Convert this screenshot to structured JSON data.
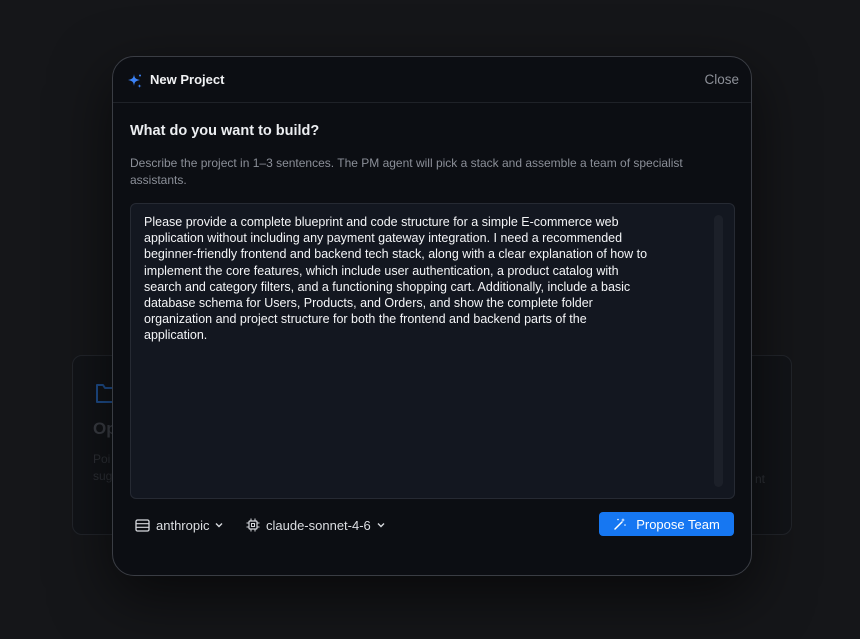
{
  "background": {
    "left_card": {
      "title": "Op",
      "description_lines": [
        "Poi",
        "sug"
      ],
      "icon": "folder-icon"
    },
    "right_card": {
      "text": "nt"
    }
  },
  "modal": {
    "title": "New Project",
    "close_label": "Close",
    "question": "What do you want to build?",
    "help_text": "Describe the project in 1–3 sentences. The PM agent will pick a stack and assemble a team of specialist assistants.",
    "prompt_value": "Please provide a complete blueprint and code structure for a simple E-commerce web\napplication without including any payment gateway integration. I need a recommended\nbeginner-friendly frontend and backend tech stack, along with a clear explanation of how to\nimplement the core features, which include user authentication, a product catalog with\nsearch and category filters, and a functioning shopping cart. Additionally, include a basic\ndatabase schema for Users, Products, and Orders, and show the complete folder\norganization and project structure for both the frontend and backend parts of the\napplication.",
    "provider": {
      "label": "anthropic",
      "icon": "server-icon"
    },
    "model": {
      "label": "claude-sonnet-4-6",
      "icon": "cpu-icon"
    },
    "propose_button": {
      "label": "Propose Team",
      "icon": "magic-wand-icon"
    }
  },
  "colors": {
    "accent": "#1677f2",
    "modal_bg": "#0c0e13",
    "page_bg": "#151619",
    "sparkle": "#3b82f6"
  }
}
